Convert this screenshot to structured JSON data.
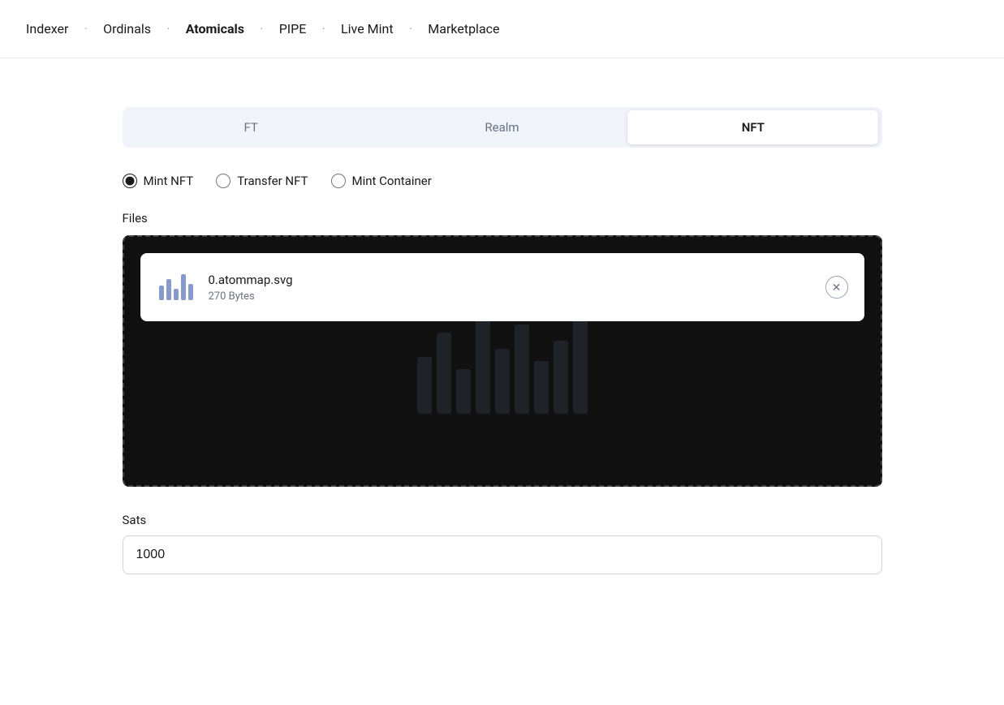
{
  "nav": {
    "items": [
      {
        "label": "Indexer",
        "active": false
      },
      {
        "label": "Ordinals",
        "active": false
      },
      {
        "label": "Atomicals",
        "active": true
      },
      {
        "label": "PIPE",
        "active": false
      },
      {
        "label": "Live Mint",
        "active": false
      },
      {
        "label": "Marketplace",
        "active": false
      }
    ]
  },
  "tabs": {
    "items": [
      {
        "label": "FT",
        "active": false
      },
      {
        "label": "Realm",
        "active": false
      },
      {
        "label": "NFT",
        "active": true
      }
    ]
  },
  "radio_group": {
    "options": [
      {
        "label": "Mint NFT",
        "checked": true,
        "value": "mint-nft"
      },
      {
        "label": "Transfer NFT",
        "checked": false,
        "value": "transfer-nft"
      },
      {
        "label": "Mint Container",
        "checked": false,
        "value": "mint-container"
      }
    ]
  },
  "files_section": {
    "label": "Files",
    "file": {
      "name": "0.atommap.svg",
      "size": "270 Bytes"
    }
  },
  "sats_section": {
    "label": "Sats",
    "value": "1000",
    "placeholder": "1000"
  }
}
